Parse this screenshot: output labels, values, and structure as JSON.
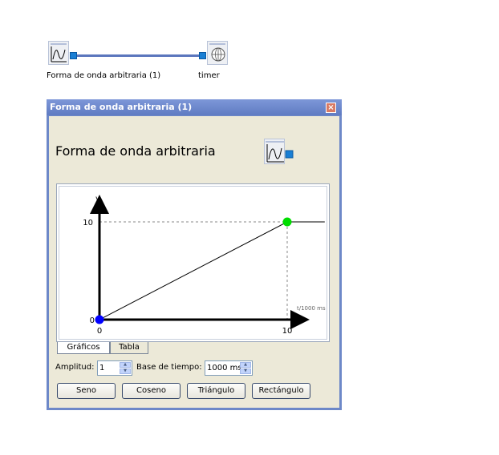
{
  "diagram": {
    "source_label": "Forma de onda arbitraria (1)",
    "target_label": "timer"
  },
  "window": {
    "title": "Forma de onda arbitraria (1)",
    "close_glyph": "×",
    "heading": "Forma de onda arbitraria"
  },
  "chart_data": {
    "type": "line",
    "x": [
      0,
      10,
      12
    ],
    "y": [
      0,
      10,
      10
    ],
    "xlabel": "t/1000  ms",
    "ylabel": "y",
    "x_ticks": [
      "0",
      "10"
    ],
    "y_ticks": [
      "0",
      "10"
    ],
    "control_points": [
      {
        "x": 0,
        "y": 0,
        "color": "#0000ff"
      },
      {
        "x": 10,
        "y": 10,
        "color": "#00dd00"
      }
    ]
  },
  "tabs": [
    {
      "label": "Gráficos",
      "active": true
    },
    {
      "label": "Tabla",
      "active": false
    }
  ],
  "form": {
    "amplitude_label": "Amplitud:",
    "amplitude_value": "1",
    "timebase_label": "Base de tiempo:",
    "timebase_value": "1000 ms"
  },
  "buttons": {
    "sine": "Seno",
    "cosine": "Coseno",
    "triangle": "Triángulo",
    "rectangle": "Rectángulo"
  },
  "icons": {
    "waveform": "waveform-icon",
    "timer": "globe-icon"
  },
  "colors": {
    "titlebar": "#6d88c8",
    "port": "#1a7fd4",
    "start_point": "#0000ff",
    "end_point": "#00dd00"
  }
}
